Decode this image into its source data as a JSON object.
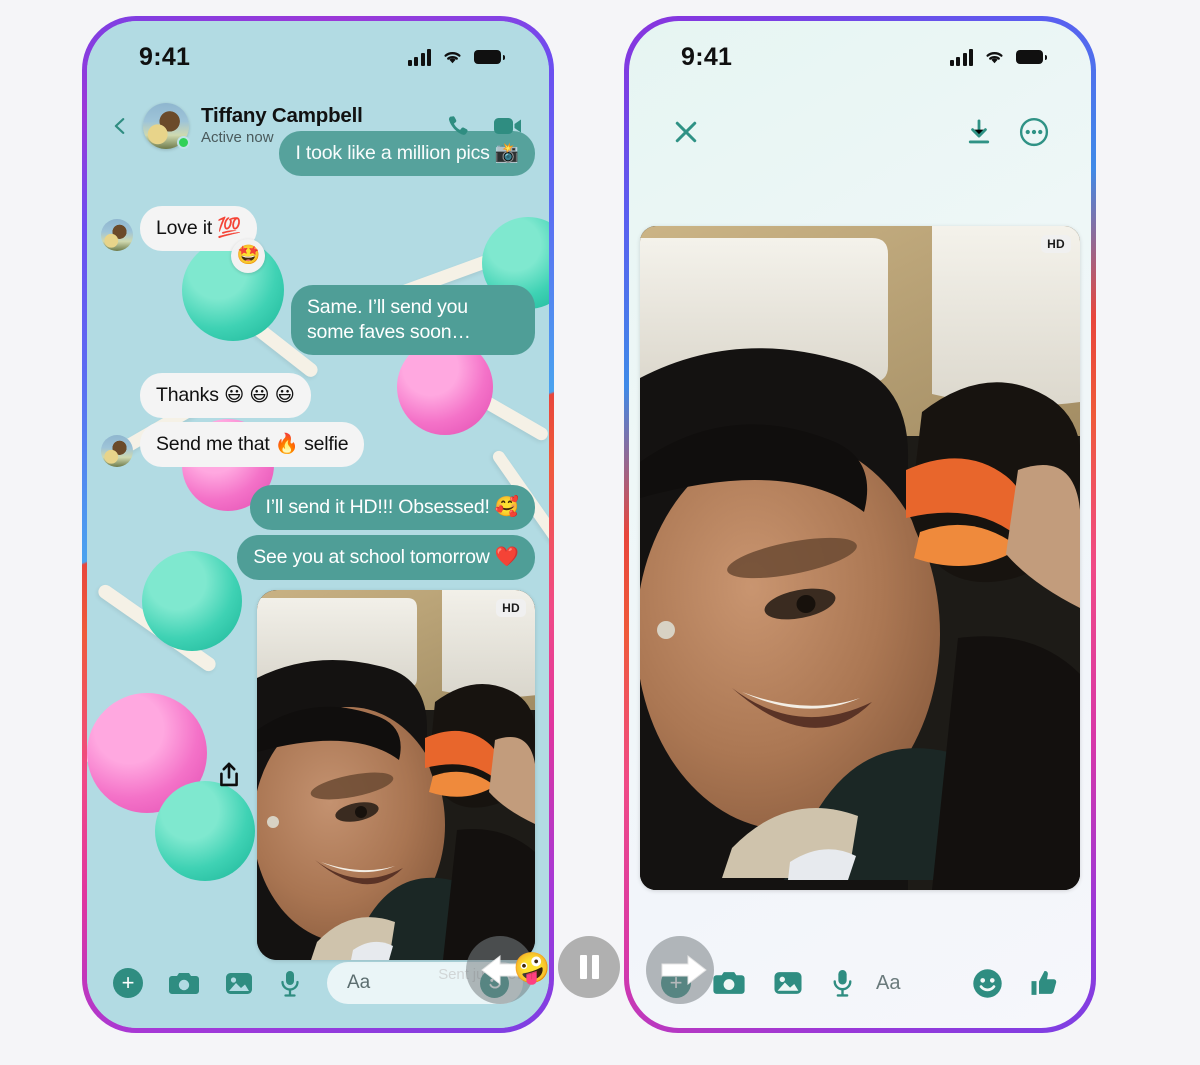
{
  "page": {
    "background_color": "#f5f5f8",
    "accent_teal": "#2f8d81",
    "bubble_out_color": "#4f9e97",
    "bubble_in_color": "#f4f4f4",
    "wallpaper_color": "#b2dbe3"
  },
  "status_bar": {
    "time": "9:41",
    "icons": [
      "cellular-signal-icon",
      "wifi-icon",
      "battery-icon"
    ]
  },
  "left_phone": {
    "header": {
      "back_icon": "chevron-left-icon",
      "contact_name": "Tiffany Campbell",
      "presence": "Active now",
      "avatar": "contact-avatar",
      "online_badge": "online-dot",
      "actions": [
        {
          "name": "voice-call-icon",
          "label": "Voice call"
        },
        {
          "name": "video-call-icon",
          "label": "Video call"
        }
      ]
    },
    "messages": [
      {
        "id": 0,
        "side": "out",
        "text": "I took like a million pics 📸",
        "clipped": true,
        "avatar": false
      },
      {
        "id": 1,
        "side": "in",
        "text": "Love it 💯",
        "avatar": true,
        "reaction": "🤩"
      },
      {
        "id": 2,
        "side": "out",
        "text": "Same. I’ll send you some faves soon…",
        "avatar": false
      },
      {
        "id": 3,
        "side": "in",
        "text": "Thanks 😃 😃 😃",
        "avatar": false
      },
      {
        "id": 4,
        "side": "in",
        "text": "Send me that 🔥 selfie",
        "avatar": true
      },
      {
        "id": 5,
        "side": "out",
        "text": "I’ll send it HD!!! Obsessed!  🥰",
        "avatar": false
      },
      {
        "id": 6,
        "side": "out",
        "text": "See you at school tomorrow ❤️",
        "avatar": false
      }
    ],
    "attachment": {
      "share_icon": "share-icon",
      "quality_badge": "HD",
      "alt": "selfie-photo-two-friends-in-car",
      "status": "Sent just now"
    },
    "composer": {
      "placeholder": "Aa",
      "icons": [
        {
          "name": "plus-icon",
          "label": "More"
        },
        {
          "name": "camera-icon",
          "label": "Camera"
        },
        {
          "name": "gallery-icon",
          "label": "Photos"
        },
        {
          "name": "microphone-icon",
          "label": "Voice"
        }
      ],
      "emoji_icon": "smiley-icon"
    },
    "cursor": {
      "direction": "left",
      "touch_emoji": "🤪"
    }
  },
  "right_phone": {
    "viewer": {
      "close_icon": "close-icon",
      "download_icon": "download-icon",
      "more_icon": "more-options-icon",
      "quality_badge": "HD",
      "alt": "selfie-photo-two-friends-in-car-fullscreen"
    },
    "composer": {
      "placeholder": "Aa",
      "icons": [
        {
          "name": "plus-icon",
          "label": "More"
        },
        {
          "name": "camera-icon",
          "label": "Camera"
        },
        {
          "name": "gallery-icon",
          "label": "Photos"
        },
        {
          "name": "microphone-icon",
          "label": "Voice"
        }
      ],
      "emoji_icon": "smiley-icon",
      "like_icon": "thumbs-up-icon"
    },
    "cursor": {
      "direction": "right"
    }
  },
  "playback": {
    "button_icon": "pause-icon",
    "state": "playing"
  }
}
